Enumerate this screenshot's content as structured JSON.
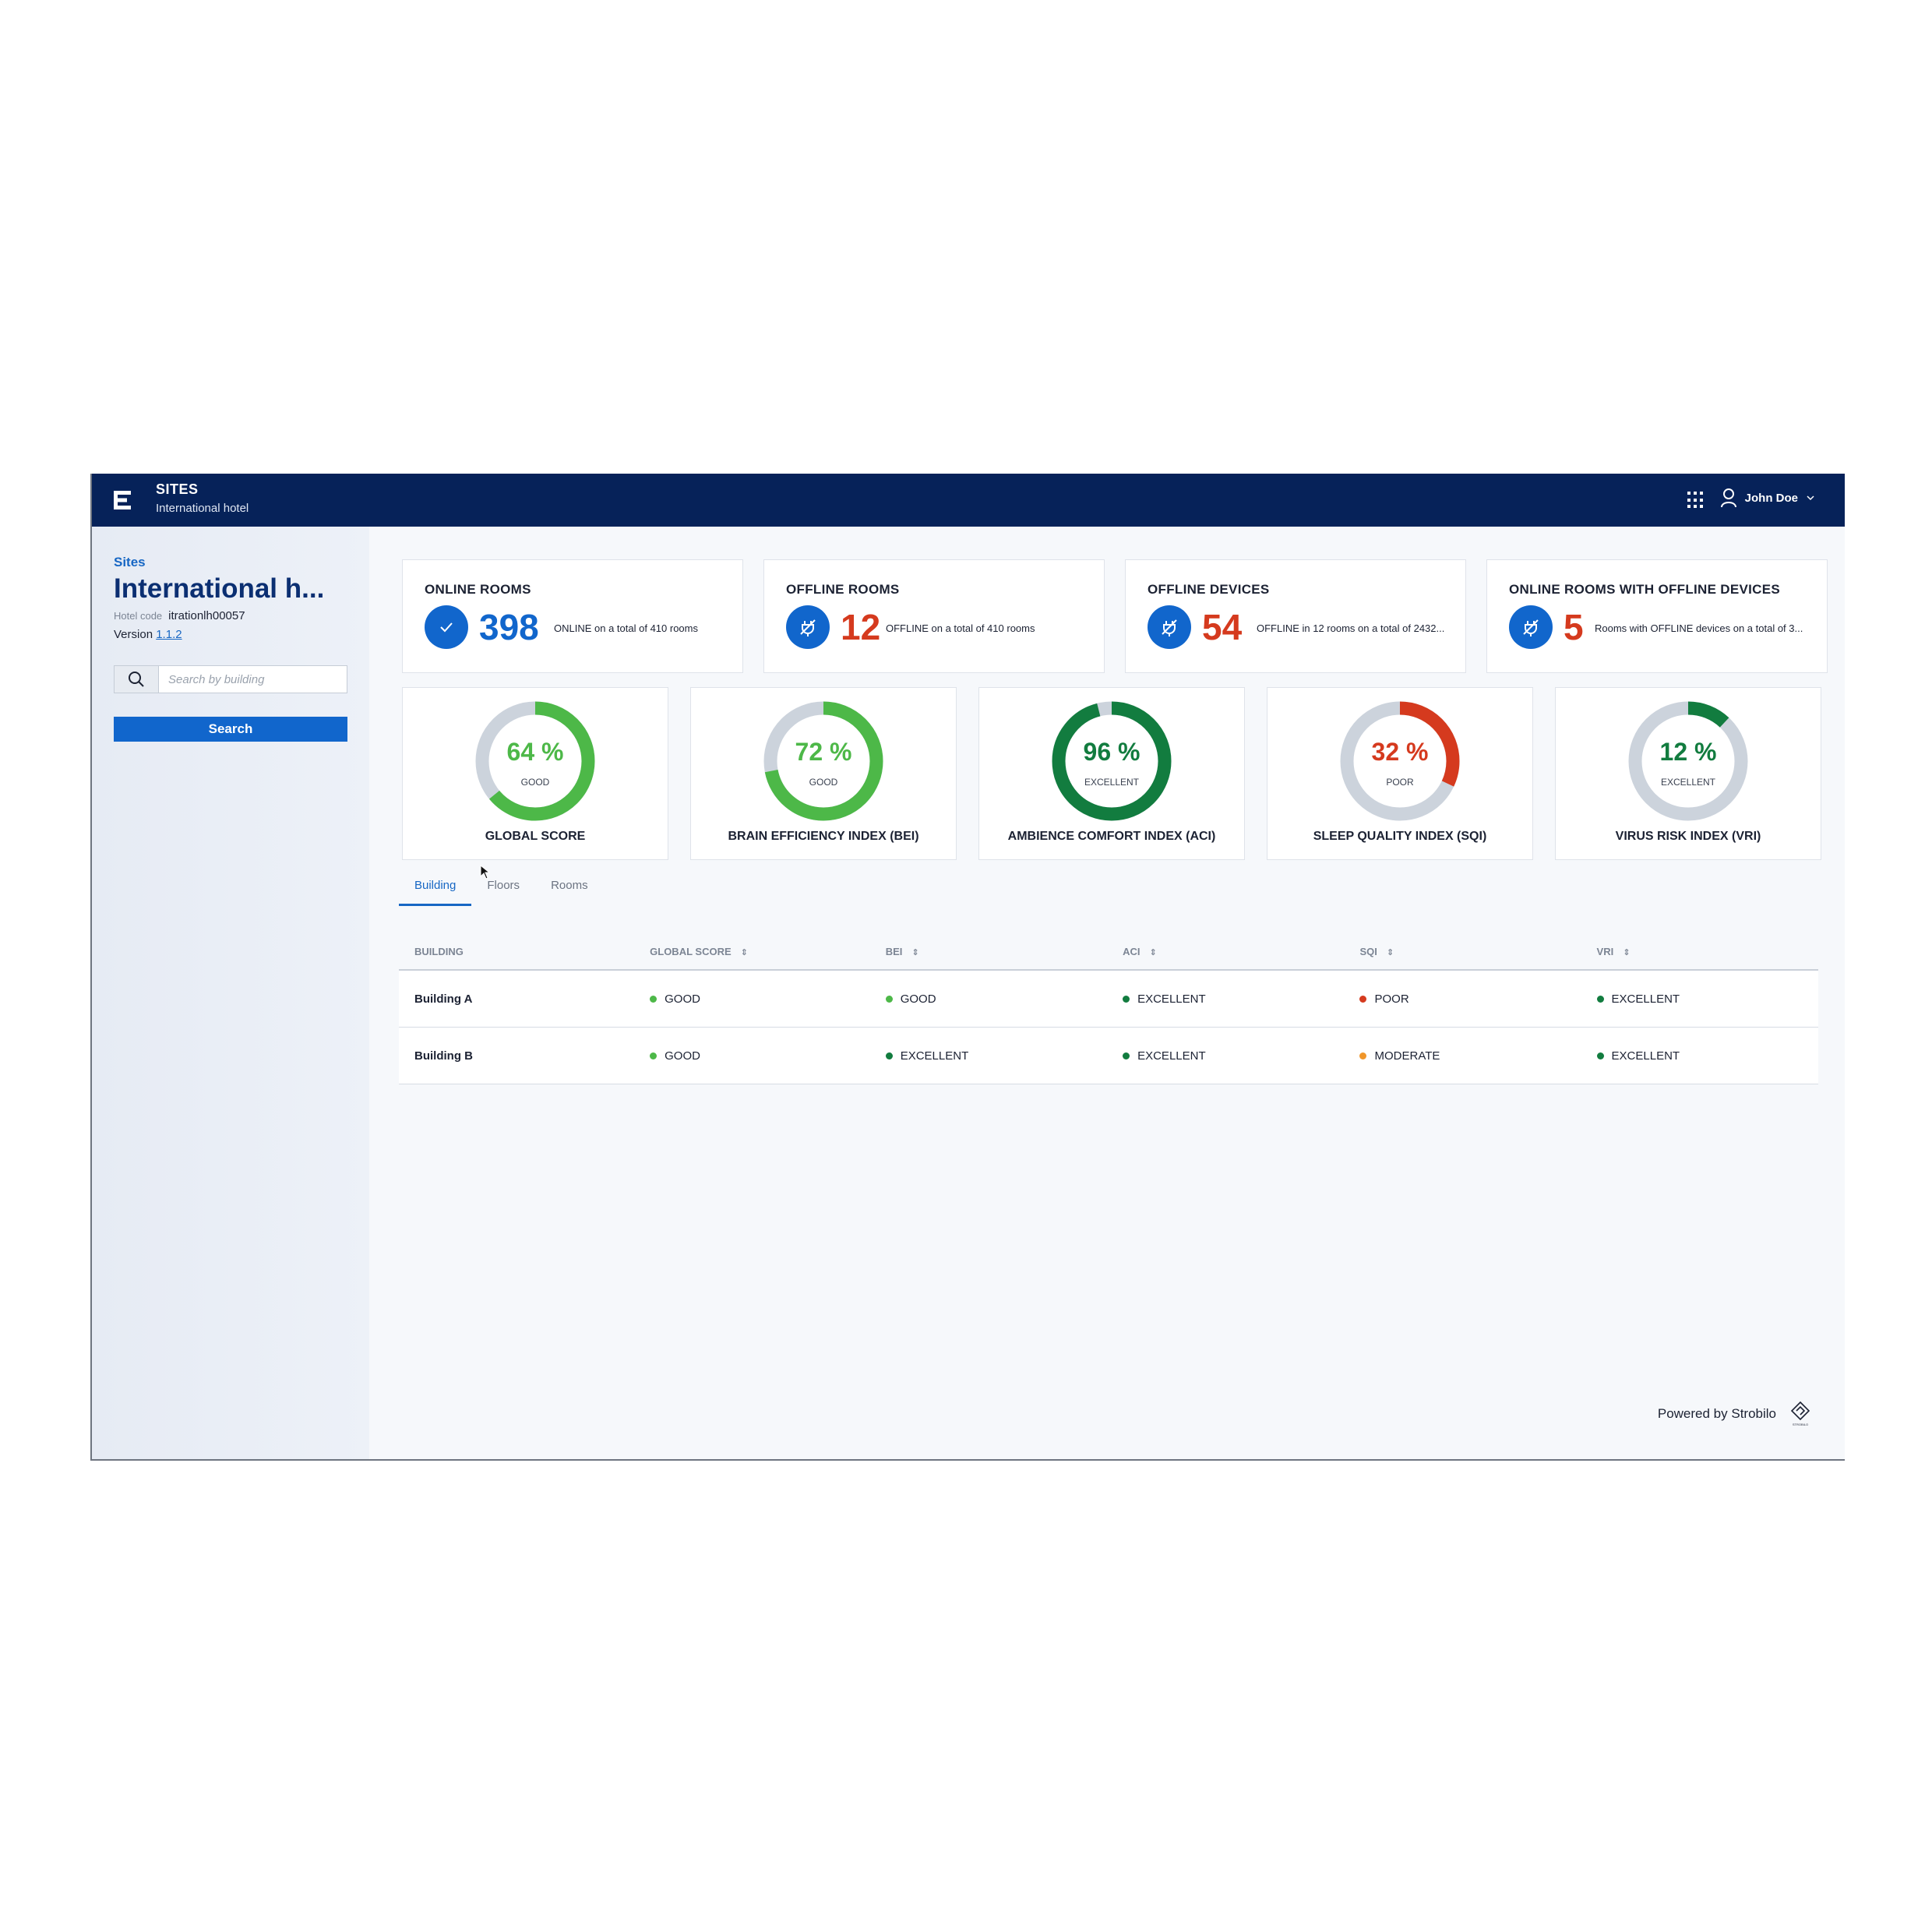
{
  "topbar": {
    "title": "SITES",
    "subtitle": "International hotel",
    "user": "John Doe"
  },
  "sidebar": {
    "crumb": "Sites",
    "title": "International h...",
    "hotel_code_label": "Hotel code",
    "hotel_code": "itrationlh00057",
    "version_label": "Version",
    "version": "1.1.2",
    "search_placeholder": "Search by building",
    "search_button": "Search"
  },
  "stats": [
    {
      "title": "ONLINE ROOMS",
      "value": "398",
      "desc": "ONLINE on a total of 410 rooms",
      "icon": "check-icon",
      "value_color": "#1166cc"
    },
    {
      "title": "OFFLINE ROOMS",
      "value": "12",
      "desc": "OFFLINE on a total of 410 rooms",
      "icon": "unplugged-icon",
      "value_color": "#d53a1e"
    },
    {
      "title": "OFFLINE DEVICES",
      "value": "54",
      "desc": "OFFLINE in 12 rooms on a total of 2432...",
      "icon": "unplugged-icon",
      "value_color": "#d53a1e"
    },
    {
      "title": "ONLINE ROOMS WITH OFFLINE DEVICES",
      "value": "5",
      "desc": "Rooms with OFFLINE devices on a total of 3...",
      "icon": "unplugged-icon",
      "value_color": "#d53a1e"
    }
  ],
  "gauges": [
    {
      "name": "GLOBAL SCORE",
      "value": "64 %",
      "percent": 64,
      "label": "GOOD",
      "color": "#4db848"
    },
    {
      "name": "BRAIN EFFICIENCY INDEX (BEI)",
      "value": "72 %",
      "percent": 72,
      "label": "GOOD",
      "color": "#4db848"
    },
    {
      "name": "AMBIENCE COMFORT INDEX (ACI)",
      "value": "96 %",
      "percent": 96,
      "label": "EXCELLENT",
      "color": "#127c3f"
    },
    {
      "name": "SLEEP QUALITY INDEX (SQI)",
      "value": "32 %",
      "percent": 32,
      "label": "POOR",
      "color": "#d53a1e"
    },
    {
      "name": "VIRUS RISK INDEX (VRI)",
      "value": "12 %",
      "percent": 12,
      "label": "EXCELLENT",
      "color": "#127c3f"
    }
  ],
  "tabs": [
    "Building",
    "Floors",
    "Rooms"
  ],
  "table": {
    "headers": [
      "BUILDING",
      "GLOBAL SCORE",
      "BEI",
      "ACI",
      "SQI",
      "VRI"
    ],
    "rows": [
      {
        "name": "Building A",
        "cells": [
          {
            "text": "GOOD",
            "color": "#4db848"
          },
          {
            "text": "GOOD",
            "color": "#4db848"
          },
          {
            "text": "EXCELLENT",
            "color": "#127c3f"
          },
          {
            "text": "POOR",
            "color": "#d53a1e"
          },
          {
            "text": "EXCELLENT",
            "color": "#127c3f"
          }
        ]
      },
      {
        "name": "Building B",
        "cells": [
          {
            "text": "GOOD",
            "color": "#4db848"
          },
          {
            "text": "EXCELLENT",
            "color": "#127c3f"
          },
          {
            "text": "EXCELLENT",
            "color": "#127c3f"
          },
          {
            "text": "MODERATE",
            "color": "#f0962a"
          },
          {
            "text": "EXCELLENT",
            "color": "#127c3f"
          }
        ]
      }
    ]
  },
  "footer": {
    "text": "Powered by Strobilo",
    "logo_text": "STROBILO"
  }
}
